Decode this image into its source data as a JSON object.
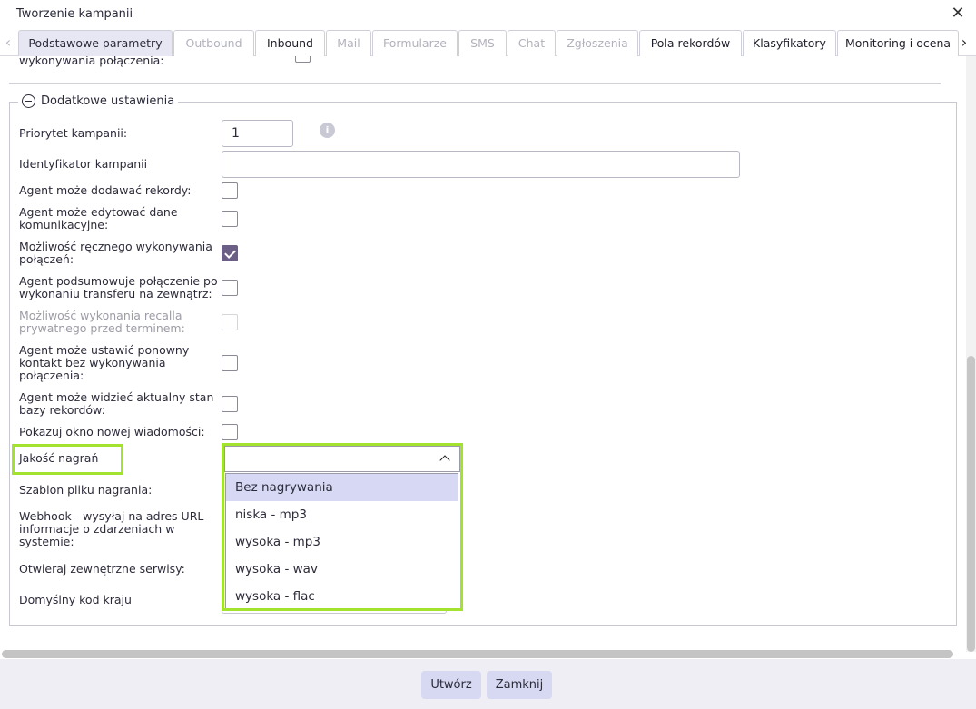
{
  "dialog": {
    "title": "Tworzenie kampanii",
    "close_glyph": "✕"
  },
  "tabs": {
    "prev_glyph": "‹",
    "next_glyph": "›",
    "items": [
      {
        "label": "Podstawowe parametry",
        "state": "active"
      },
      {
        "label": "Outbound",
        "state": "disabled"
      },
      {
        "label": "Inbound",
        "state": "enabled"
      },
      {
        "label": "Mail",
        "state": "disabled"
      },
      {
        "label": "Formularze",
        "state": "disabled"
      },
      {
        "label": "SMS",
        "state": "disabled"
      },
      {
        "label": "Chat",
        "state": "disabled"
      },
      {
        "label": "Zgłoszenia",
        "state": "disabled"
      },
      {
        "label": "Pola rekordów",
        "state": "enabled"
      },
      {
        "label": "Klasyfikatory",
        "state": "enabled"
      },
      {
        "label": "Monitoring i ocena",
        "state": "enabled"
      }
    ]
  },
  "previous_section": {
    "cut_label": "wykonywania połączenia:"
  },
  "section": {
    "legend": "Dodatkowe ustawienia",
    "priority": {
      "label": "Priorytet kampanii:",
      "value": "1",
      "info_glyph": "i"
    },
    "identifier": {
      "label": "Identyfikator kampanii",
      "value": ""
    },
    "checkboxes": [
      {
        "label": "Agent może dodawać rekordy:",
        "checked": false,
        "disabled": false
      },
      {
        "label": "Agent może edytować dane komunikacyjne:",
        "checked": false,
        "disabled": false
      },
      {
        "label": "Możliwość ręcznego wykonywania połączeń:",
        "checked": true,
        "disabled": false
      },
      {
        "label": "Agent podsumowuje połączenie po wykonaniu transferu na zewnątrz:",
        "checked": false,
        "disabled": false
      },
      {
        "label": "Możliwość wykonania recalla prywatnego przed terminem:",
        "checked": false,
        "disabled": true
      },
      {
        "label": "Agent może ustawić ponowny kontakt bez wykonywania połączenia:",
        "checked": false,
        "disabled": false
      },
      {
        "label": "Agent może widzieć aktualny stan bazy rekordów:",
        "checked": false,
        "disabled": false
      },
      {
        "label": "Pokazuj okno nowej wiadomości:",
        "checked": false,
        "disabled": false
      }
    ],
    "recording_quality": {
      "label": "Jakość nagrań",
      "value": "",
      "options": [
        "Bez nagrywania",
        "niska - mp3",
        "wysoka - mp3",
        "wysoka - wav",
        "wysoka - flac"
      ],
      "highlighted_option": "Bez nagrywania"
    },
    "other_labels": {
      "recording_template": "Szablon pliku nagrania:",
      "webhook": "Webhook - wysyłaj na adres URL informacje o zdarzeniach w systemie:",
      "external_services": "Otwieraj zewnętrzne serwisy:",
      "country_code": "Domyślny kod kraju"
    }
  },
  "footer": {
    "create_label": "Utwórz",
    "close_label": "Zamknij"
  },
  "colors": {
    "highlight": "#a3e22e",
    "active_tab": "#e7e7f4",
    "checkbox_checked": "#6b5f85",
    "selected_option": "#d6d8f4",
    "button": "#d7d8f2"
  }
}
